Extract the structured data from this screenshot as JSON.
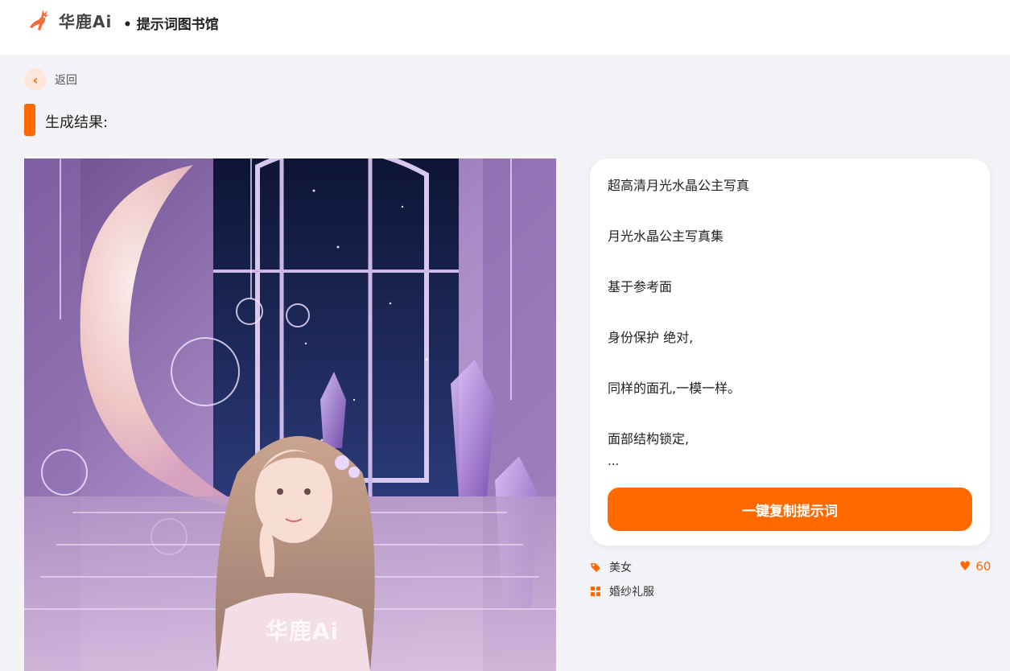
{
  "header": {
    "logo_text": "华鹿Ai",
    "page_title": "• 提示词图书馆"
  },
  "nav": {
    "back_label": "返回"
  },
  "section": {
    "title": "生成结果:"
  },
  "image": {
    "watermark": "华鹿Ai"
  },
  "prompt": {
    "lines": [
      "超高清月光水晶公主写真",
      "月光水晶公主写真集",
      "基于参考面",
      "身份保护 绝对,",
      "同样的面孔,一模一样。",
      "面部结构锁定,"
    ],
    "ellipsis": "...",
    "copy_button": "一键复制提示词"
  },
  "meta": {
    "category_icon": "tag-icon",
    "category": "美女",
    "subcategory_icon": "grid-icon",
    "subcategory": "婚纱礼服",
    "likes_icon": "heart-icon",
    "likes": "60"
  },
  "colors": {
    "accent": "#ff6a00",
    "background": "#f4f4f8"
  }
}
